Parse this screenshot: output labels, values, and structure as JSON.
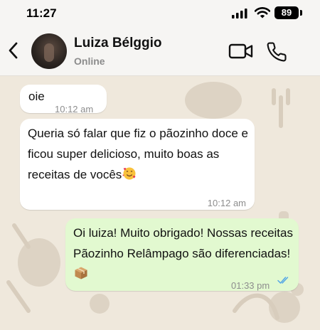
{
  "status_bar": {
    "time": "11:27",
    "battery": "89",
    "icons": [
      "cellular-signal-icon",
      "wifi-icon",
      "battery-icon"
    ]
  },
  "header": {
    "back_icon": "chevron-left-icon",
    "contact_name": "Luiza Bélggio",
    "presence": "Online",
    "video_icon": "video-camera-icon",
    "phone_icon": "phone-icon"
  },
  "messages": [
    {
      "direction": "incoming",
      "text": "oie",
      "time": "10:12 am"
    },
    {
      "direction": "incoming",
      "text": " Queria só falar que fiz o pãozinho doce e ficou super delicioso, muito boas as receitas de vocês",
      "emoji": "smiling-face-with-hearts-emoji",
      "time": "10:12 am"
    },
    {
      "direction": "outgoing",
      "text": " Oi luiza! Muito obrigado! Nossas receitas Pãozinho Relâmpago são diferenciadas!",
      "emoji": "package-emoji",
      "time": "01:33 pm",
      "status_icon": "double-check-read-icon"
    }
  ],
  "colors": {
    "incoming_bubble": "#ffffff",
    "outgoing_bubble": "#e2f9d0",
    "read_ticks": "#53a6e6",
    "chat_background": "#efe8dc"
  }
}
